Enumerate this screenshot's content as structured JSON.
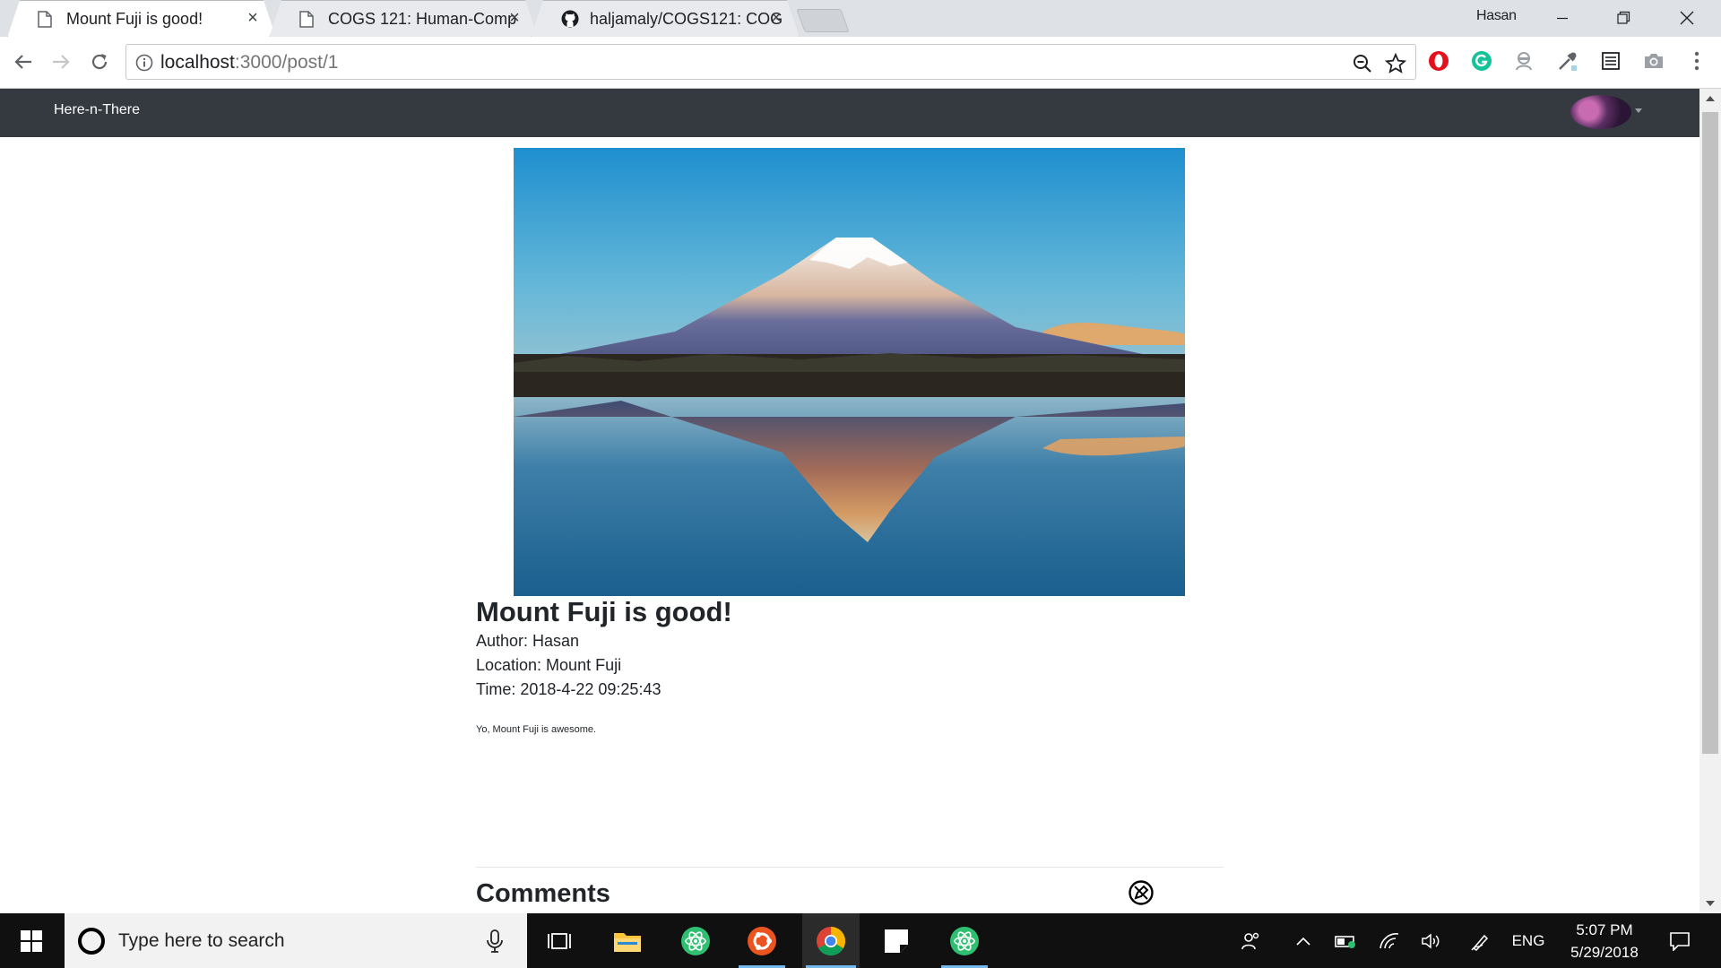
{
  "browser": {
    "tabs": [
      {
        "title": "Mount Fuji is good!",
        "favicon": "page-icon",
        "active": true
      },
      {
        "title": "COGS 121: Human-Comp",
        "favicon": "page-icon",
        "active": false
      },
      {
        "title": "haljamaly/COGS121: COG",
        "favicon": "github-icon",
        "active": false
      }
    ],
    "close_glyph": "×",
    "profile_name": "Hasan",
    "url_host": "localhost",
    "url_rest": ":3000/post/1"
  },
  "site": {
    "brand": "Here-n-There"
  },
  "post": {
    "title": "Mount Fuji is good!",
    "author_line": "Author: Hasan",
    "location_line": "Location: Mount Fuji",
    "time_line": "Time: 2018-4-22 09:25:43",
    "body": "Yo, Mount Fuji is awesome.",
    "comments_heading": "Comments"
  },
  "taskbar": {
    "search_placeholder": "Type here to search",
    "language": "ENG",
    "time": "5:07 PM",
    "date": "5/29/2018"
  },
  "colors": {
    "navbar": "#343a40",
    "taskbar": "#101010",
    "chrome_tabbar": "#dee1e6"
  }
}
